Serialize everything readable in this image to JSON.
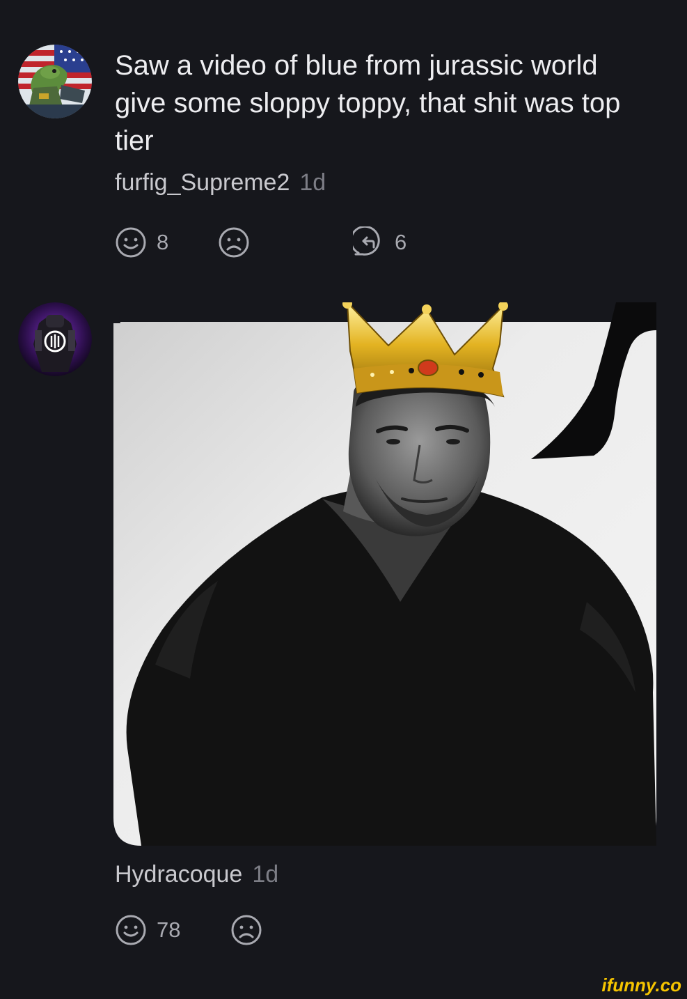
{
  "comments": [
    {
      "text": "Saw a video of blue from jurassic world give some sloppy toppy, that shit was top tier",
      "username": "furfig_Supreme2",
      "time": "1d",
      "smiles": "8",
      "replies": "6"
    },
    {
      "username": "Hydracoque",
      "time": "1d",
      "smiles": "78"
    }
  ],
  "icons": {
    "smile": "smile-icon",
    "unsmile": "unsmile-icon",
    "reply": "reply-icon"
  },
  "colors": {
    "background": "#16171c",
    "text": "#ededf0",
    "muted": "#7d7e86",
    "watermark": "#f5c400"
  },
  "watermark": "ifunny.co"
}
